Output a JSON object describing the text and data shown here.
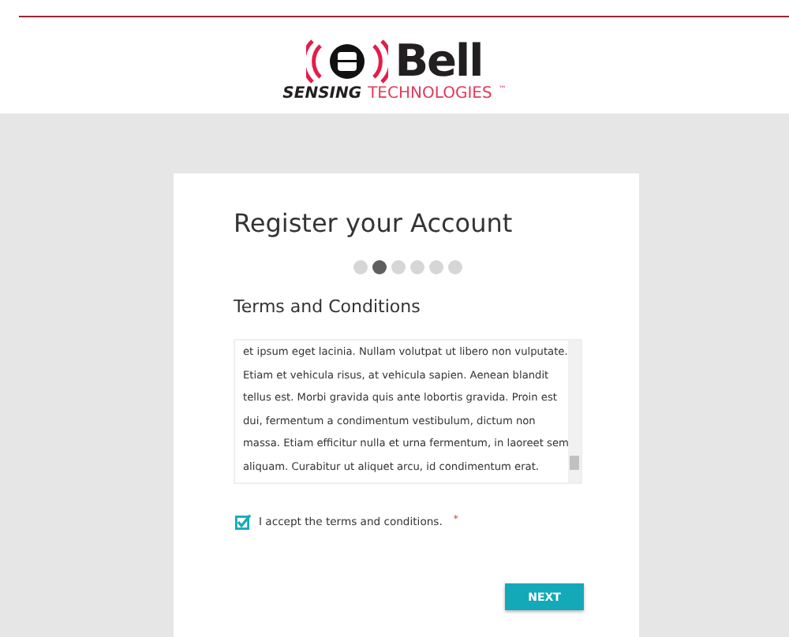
{
  "logo": {
    "name": "Bell",
    "tagline_strong": "SENSING",
    "tagline": "TECHNOLOGIES",
    "trademark": "™"
  },
  "card": {
    "title": "Register your Account",
    "steps": [
      {
        "selected": false
      },
      {
        "selected": true
      },
      {
        "selected": false
      },
      {
        "selected": false
      },
      {
        "selected": false
      },
      {
        "selected": false
      }
    ],
    "section_title": "Terms and Conditions",
    "terms_lines": [
      "et ipsum eget lacinia. Nullam volutpat ut libero non vulputate.",
      "Etiam et vehicula risus, at vehicula sapien. Aenean blandit",
      "tellus est. Morbi gravida quis ante lobortis gravida. Proin est",
      "dui, fermentum a condimentum vestibulum, dictum non",
      "massa. Etiam efficitur nulla et urna fermentum, in laoreet sem",
      "aliquam. Curabitur ut aliquet arcu, id condimentum erat."
    ],
    "accept": {
      "label": "I accept the terms and conditions.",
      "required_mark": "*",
      "checked": true
    },
    "next_button": "NEXT"
  }
}
